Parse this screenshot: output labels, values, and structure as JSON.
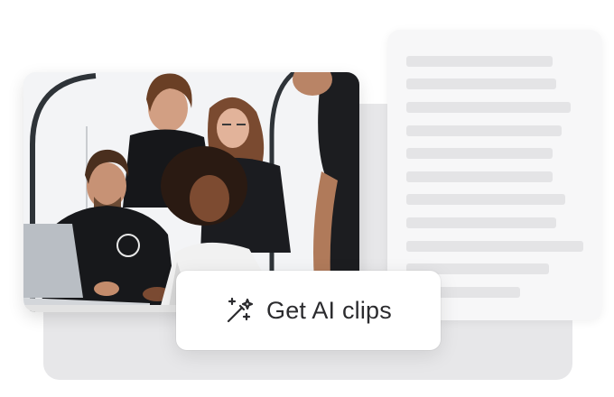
{
  "cta": {
    "label": "Get AI clips",
    "icon": "magic-wand-icon"
  },
  "photo": {
    "description_icon": "team-photo"
  },
  "colors": {
    "background": "#ffffff",
    "panel": "#e7e7e9",
    "doc_card": "#f7f7f8",
    "doc_line": "#e4e4e6",
    "text": "#2b2b2e"
  }
}
